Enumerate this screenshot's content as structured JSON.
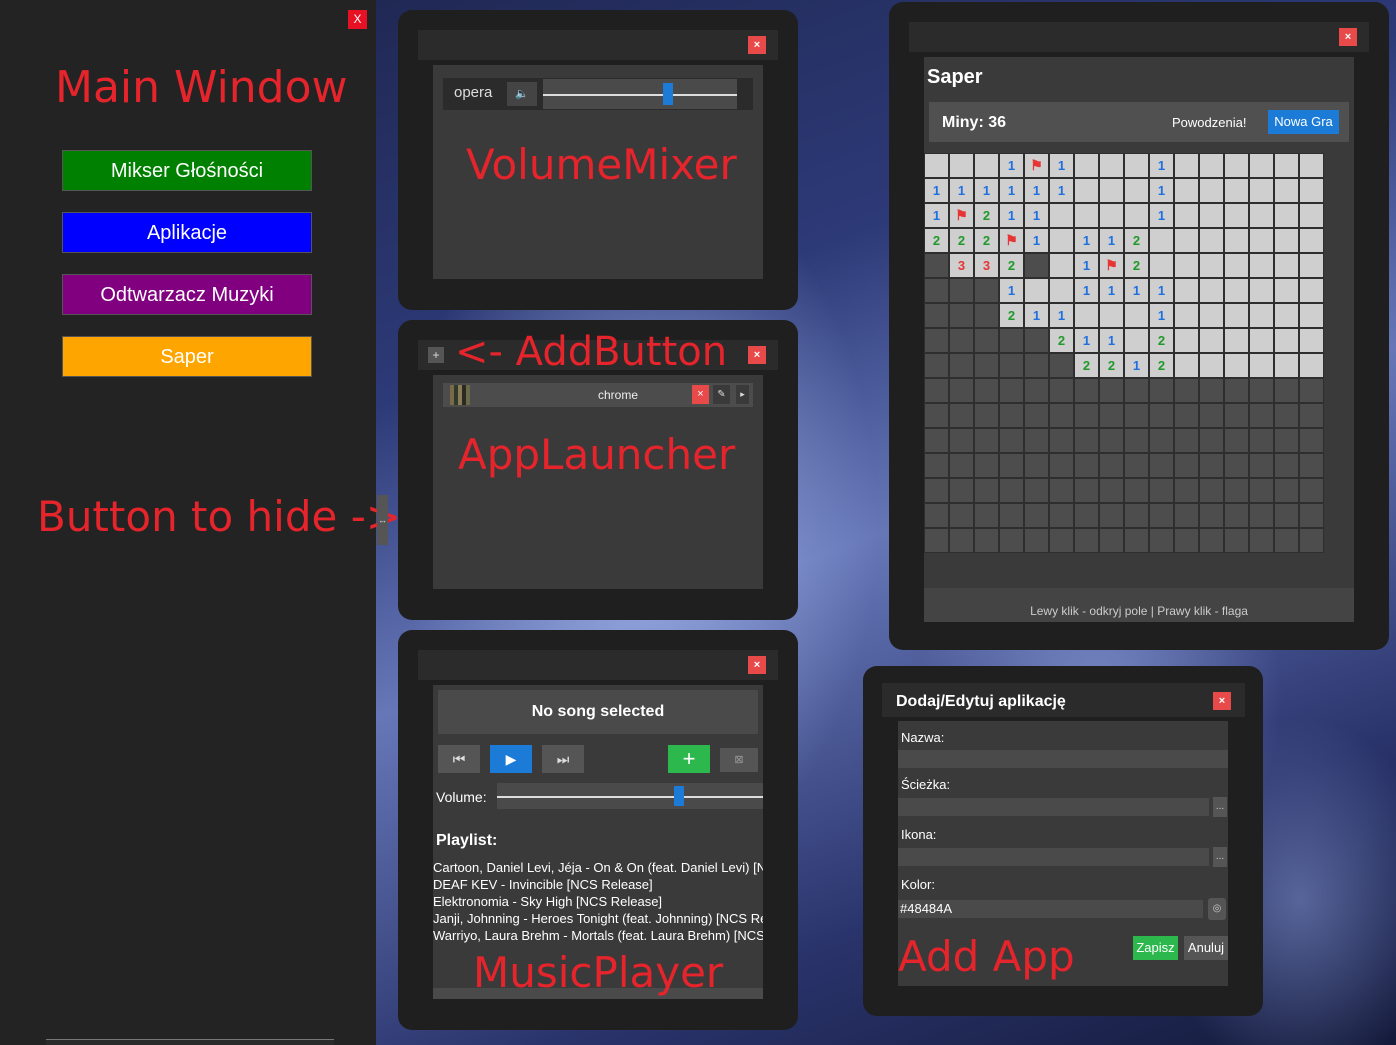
{
  "main": {
    "close_label": "X",
    "title": "Main Window",
    "buttons": [
      {
        "label": "Mikser Głośności",
        "color": "#008000"
      },
      {
        "label": "Aplikacje",
        "color": "#0000ff"
      },
      {
        "label": "Odtwarzacz Muzyki",
        "color": "#800080"
      },
      {
        "label": "Saper",
        "color": "#ffa500"
      }
    ],
    "hide_annotation": "Button to hide ->",
    "hide_handle_icon": "arrow-icon"
  },
  "mixer": {
    "close_label": "×",
    "app_name": "opera",
    "mute_icon": "speaker-icon",
    "volume_fraction": 0.65,
    "annotation": "VolumeMixer"
  },
  "launcher": {
    "close_label": "×",
    "add_label": "+",
    "add_annotation": "<- AddButton",
    "app_name": "chrome",
    "app_delete_label": "×",
    "app_edit_icon": "edit-icon",
    "app_run_icon": "play-icon",
    "annotation": "AppLauncher"
  },
  "player": {
    "close_label": "×",
    "song_title": "No song selected",
    "volume_label": "Volume:",
    "volume_fraction": 0.69,
    "playlist_label": "Playlist:",
    "playlist": [
      "Cartoon, Daniel Levi, Jéja - On & On (feat. Daniel Levi) [NCS Release]",
      "DEAF KEV - Invincible [NCS Release]",
      "Elektronomia - Sky High [NCS Release]",
      "Janji, Johnning - Heroes Tonight (feat. Johnning) [NCS Release]",
      "Warriyo, Laura Brehm - Mortals (feat. Laura Brehm) [NCS Release]"
    ],
    "add_song_label": "+",
    "annotation": "MusicPlayer"
  },
  "saper": {
    "close_label": "×",
    "title": "Saper",
    "mines_label": "Miny: 36",
    "status": "Powodzenia!",
    "new_game_label": "Nowa Gra",
    "footer": "Lewy klik - odkryj pole | Prawy klik - flaga",
    "grid": [
      "...1F1...1......",
      "111111...1......",
      "1F211....1......",
      "222F1.112.......",
      "#332#.1F2.......",
      "###1..1111......",
      "###211...1......",
      "#####211.2......",
      "######2212......",
      "################",
      "################",
      "################",
      "################",
      "################",
      "################",
      "################"
    ]
  },
  "addapp": {
    "title": "Dodaj/Edytuj aplikację",
    "close_label": "×",
    "name_label": "Nazwa:",
    "path_label": "Ścieżka:",
    "icon_label": "Ikona:",
    "color_label": "Kolor:",
    "color_value": "#48484A",
    "browse_label": "...",
    "save_label": "Zapisz",
    "cancel_label": "Anuluj",
    "annotation": "Add App"
  }
}
